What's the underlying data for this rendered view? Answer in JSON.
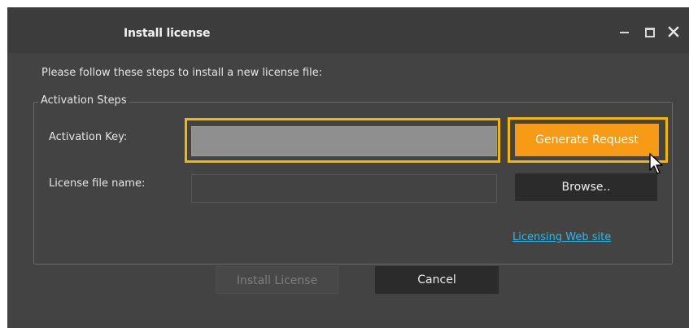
{
  "window": {
    "title": "Install license",
    "controls": {
      "minimize_icon": "minimize-icon",
      "maximize_icon": "maximize-icon",
      "close_icon": "close-icon"
    }
  },
  "dialog": {
    "instructions": "Please follow these steps to install a new license file:",
    "group_title": "Activation Steps",
    "activation_key": {
      "label": "Activation Key:",
      "value": ""
    },
    "license_file": {
      "label": "License file name:",
      "value": ""
    },
    "generate_button": "Generate Request",
    "browse_button": "Browse..",
    "link": "Licensing Web site",
    "install_button": "Install License",
    "cancel_button": "Cancel"
  },
  "colors": {
    "window_bg": "#434343",
    "titlebar_bg": "#3c3c3c",
    "accent_orange": "#f79a16",
    "highlight_yellow": "#f5b800",
    "link_blue": "#2ab8e8",
    "dark_button": "#2b2b2b"
  }
}
